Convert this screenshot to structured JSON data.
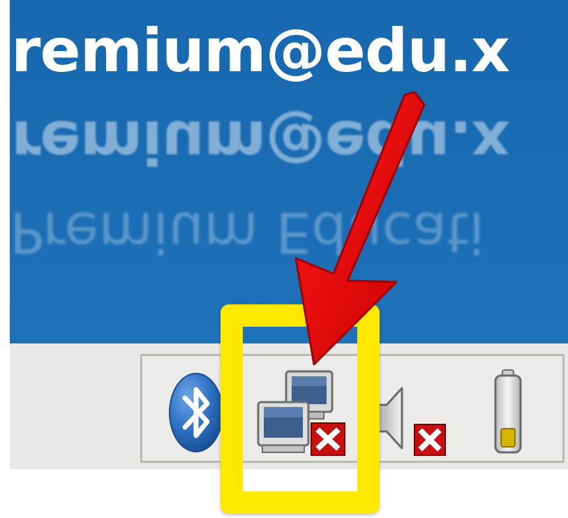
{
  "desktop": {
    "email_text": "remium@edu.x",
    "email_reflection": "remium@edu.x",
    "subtitle_reflection": "Premium Educati"
  },
  "tray": {
    "icons": [
      {
        "name": "bluetooth-icon"
      },
      {
        "name": "network-disconnected-icon"
      },
      {
        "name": "volume-muted-icon"
      },
      {
        "name": "battery-icon"
      }
    ]
  },
  "annotation": {
    "highlight_color": "#ffe800",
    "arrow_color": "#e00000"
  }
}
